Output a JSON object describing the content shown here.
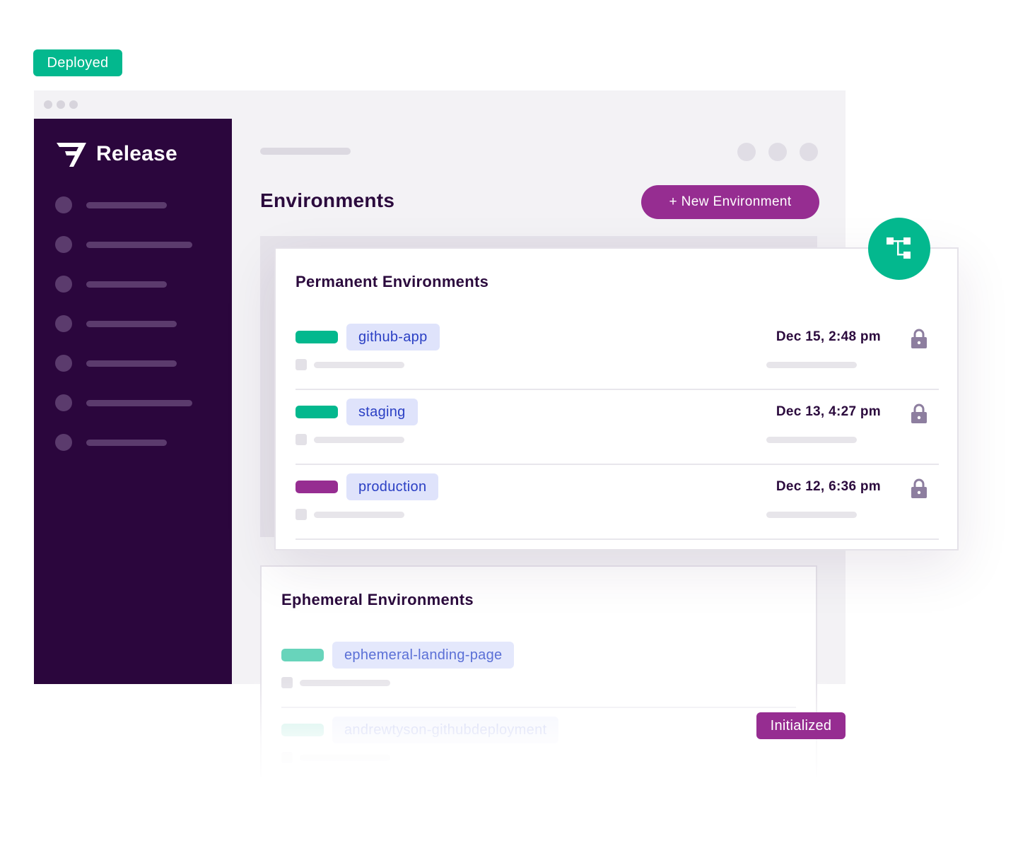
{
  "badges": {
    "deployed": "Deployed",
    "initialized": "Initialized"
  },
  "sidebar": {
    "brand": "Release",
    "nav_item_count": 7
  },
  "header": {
    "title": "Environments",
    "new_env_button": "+ New Environment"
  },
  "permanent": {
    "title": "Permanent Environments",
    "rows": [
      {
        "name": "github-app",
        "date": "Dec 15, 2:48 pm",
        "status_color": "#03b88e"
      },
      {
        "name": "staging",
        "date": "Dec 13, 4:27 pm",
        "status_color": "#03b88e"
      },
      {
        "name": "production",
        "date": "Dec 12, 6:36 pm",
        "status_color": "#962d91"
      }
    ]
  },
  "ephemeral": {
    "title": "Ephemeral Environments",
    "rows": [
      {
        "name": "ephemeral-landing-page",
        "status_color": "#03b88e"
      },
      {
        "name": "andrewtyson-githubdeployment",
        "status_color": "#03b88e"
      }
    ]
  },
  "colors": {
    "sidebar_bg": "#2b063d",
    "accent_purple": "#962d91",
    "accent_green": "#03b88e",
    "tag_bg": "#dfe3fb",
    "tag_text": "#2a3fc4"
  },
  "icons": {
    "brand": "release-logo-icon",
    "branch": "branch-icon",
    "lock": "lock-icon"
  }
}
